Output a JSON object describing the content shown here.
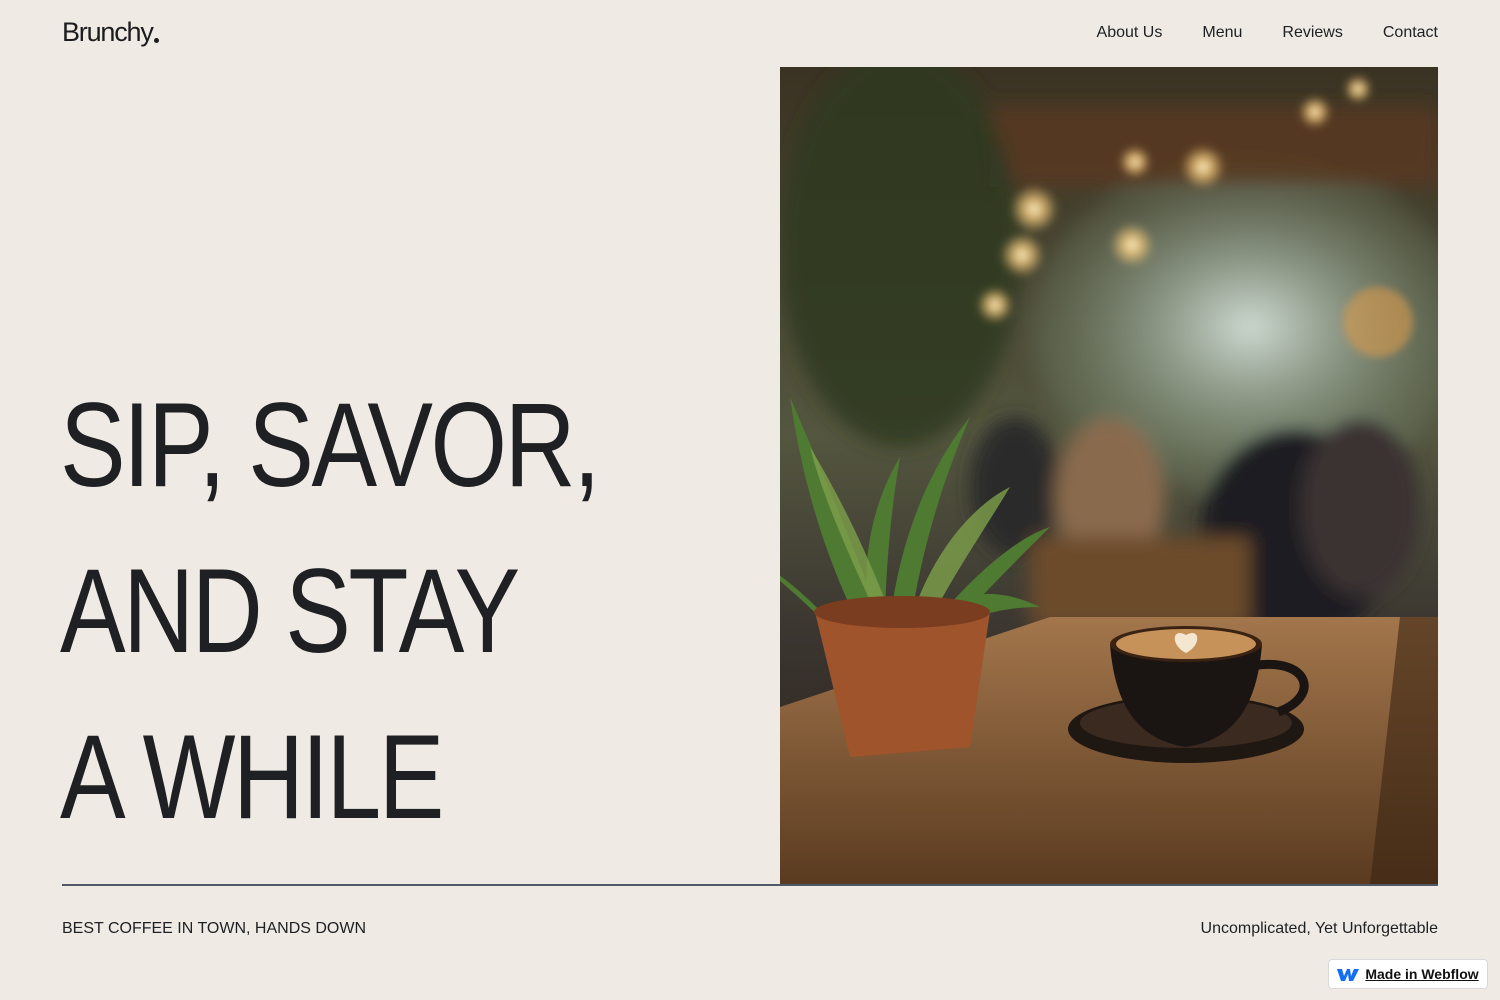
{
  "brand": {
    "name": "Brunchy",
    "accent": "#1c1c1e",
    "background": "#efebe4"
  },
  "nav": {
    "items": [
      {
        "label": "About Us"
      },
      {
        "label": "Menu"
      },
      {
        "label": "Reviews"
      },
      {
        "label": "Contact"
      }
    ]
  },
  "hero": {
    "title_lines": [
      "SIP, SAVOR,",
      "AND STAY",
      "A WHILE"
    ],
    "image_icon": "cafe-photo"
  },
  "footer": {
    "tagline_left": "BEST COFFEE IN TOWN, HANDS DOWN",
    "tagline_right": "Uncomplicated, Yet Unforgettable"
  },
  "badge": {
    "label": "Made in Webflow",
    "icon": "webflow-logo-icon",
    "color": "#146ef5"
  }
}
